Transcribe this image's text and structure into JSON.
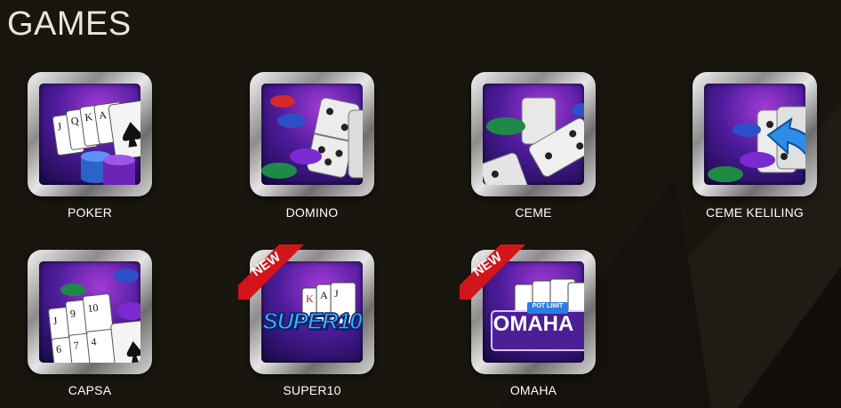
{
  "section": {
    "title": "GAMES"
  },
  "games": [
    {
      "label": "POKER"
    },
    {
      "label": "DOMINO"
    },
    {
      "label": "CEME"
    },
    {
      "label": "CEME KELILING"
    },
    {
      "label": "CAPSA"
    },
    {
      "label": "SUPER10",
      "badge": "NEW",
      "logo_text": "SUPER10"
    },
    {
      "label": "OMAHA",
      "badge": "NEW",
      "logo_text": "OMAHA",
      "sub_logo_text": "POT LIMIT"
    }
  ],
  "colors": {
    "background": "#191610",
    "title": "#eae6df",
    "label": "#ffffff",
    "badge": "#d3141b",
    "frame": "#c8c8c8",
    "inner_bg": "#4e1c9c"
  },
  "icons": [
    "poker-icon",
    "domino-icon",
    "ceme-icon",
    "ceme-keliling-icon",
    "capsa-icon",
    "super10-icon",
    "omaha-icon"
  ]
}
